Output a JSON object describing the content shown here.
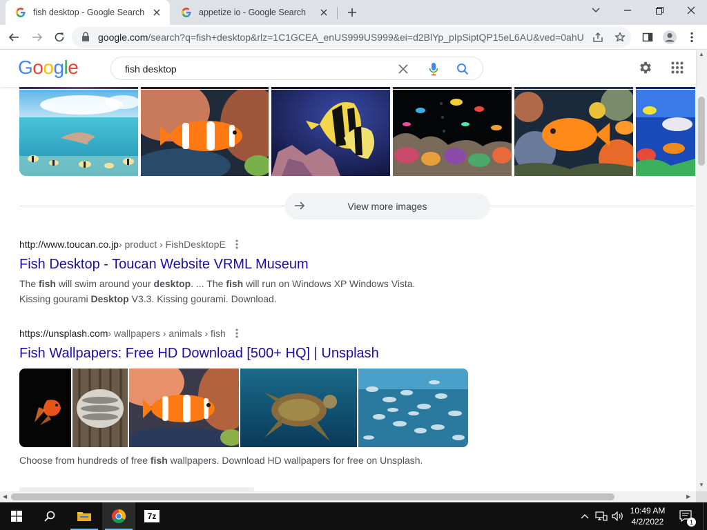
{
  "browser": {
    "tabs": [
      {
        "title": "fish desktop - Google Search",
        "active": true
      },
      {
        "title": "appetize io - Google Search",
        "active": false
      }
    ],
    "url_host": "google.com",
    "url_path": "/search?q=fish+desktop&rlz=1C1GCEA_enUS999US999&ei=d2BlYp_pIpSiptQP15eL6AU&ved=0ahU..."
  },
  "google": {
    "logo": [
      "G",
      "o",
      "o",
      "g",
      "l",
      "e"
    ],
    "logo_colors": [
      "#4285f4",
      "#ea4335",
      "#fbbc05",
      "#4285f4",
      "#34a853",
      "#ea4335"
    ],
    "query": "fish desktop",
    "accent": "#1a73e8",
    "link_color": "#1a0dab"
  },
  "images": {
    "view_more_label": "View more images"
  },
  "results": [
    {
      "cite_domain": "http://www.toucan.co.jp",
      "cite_path": " › product › FishDesktopE",
      "title": "Fish Desktop - Toucan Website VRML Museum",
      "snippet_line1": [
        {
          "t": "The ",
          "b": false
        },
        {
          "t": "fish",
          "b": true
        },
        {
          "t": " will swim around your ",
          "b": false
        },
        {
          "t": "desktop",
          "b": true
        },
        {
          "t": ". ... The ",
          "b": false
        },
        {
          "t": "fish",
          "b": true
        },
        {
          "t": " will run on Windows XP Windows Vista.",
          "b": false
        }
      ],
      "snippet_line2": [
        {
          "t": "Kissing gourami ",
          "b": false
        },
        {
          "t": "Desktop",
          "b": true
        },
        {
          "t": " V3.3. Kissing gourami. Download.",
          "b": false
        }
      ]
    },
    {
      "cite_domain": "https://unsplash.com",
      "cite_path": " › wallpapers › animals › fish",
      "title": "Fish Wallpapers: Free HD Download [500+ HQ] | Unsplash",
      "snippet_line1": [
        {
          "t": "Choose from hundreds of free ",
          "b": false
        },
        {
          "t": "fish",
          "b": true
        },
        {
          "t": " wallpapers. Download HD wallpapers for free on Unsplash.",
          "b": false
        }
      ]
    }
  ],
  "taskbar": {
    "time": "10:49 AM",
    "date": "4/2/2022",
    "notification_count": "1",
    "app_7z_label": "7z"
  }
}
